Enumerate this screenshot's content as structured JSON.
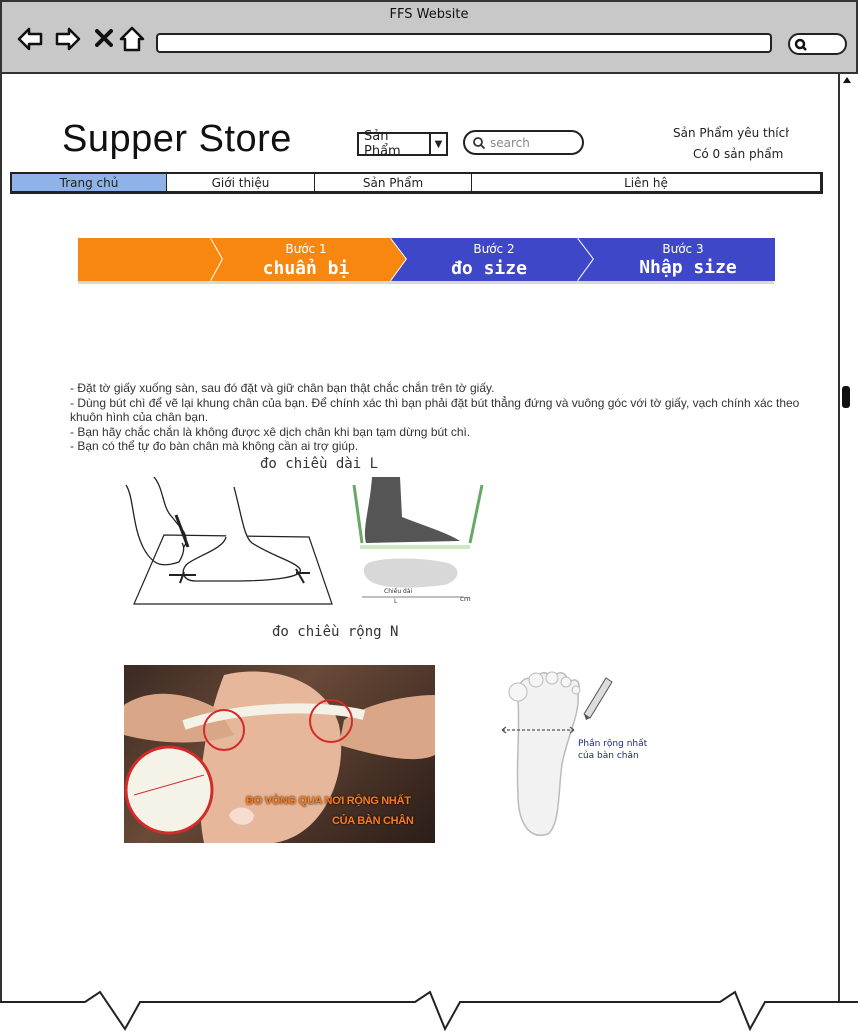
{
  "browser": {
    "title": "FFS Website",
    "icons": [
      "back-arrow-icon",
      "forward-arrow-icon",
      "close-x-icon",
      "home-icon",
      "search-icon"
    ]
  },
  "header": {
    "logo": "Supper Store",
    "category_select": "Sản Phẩm",
    "search_placeholder": "search",
    "favorites": "Sản Phẩm yêu thích",
    "cart": "Có 0 sản phẩm"
  },
  "nav": {
    "items": [
      "Trang chủ",
      "Giới thiệu",
      "Sản Phẩm",
      "Liên hệ"
    ],
    "active_index": 0
  },
  "steps": [
    {
      "label": "",
      "title": ""
    },
    {
      "label": "Bước 1",
      "title": "chuẩn bị"
    },
    {
      "label": "Bước 2",
      "title": "đo size"
    },
    {
      "label": "Bước 3",
      "title": "Nhập size"
    }
  ],
  "instructions": [
    "- Đặt tờ giấy xuống sàn, sau đó đặt và giữ chân bạn thật chắc chắn trên tờ giấy.",
    "- Dùng bút chì để vẽ lại khung chân của bạn. Để chính xác thì bạn phải đặt bút thẳng đứng và vuông góc với tờ giấy, vạch chính xác theo khuôn hình của chân bạn.",
    "- Bạn hãy chắc chắn là không được xê dịch chân khi bạn tạm dừng bút chì.",
    "- Bạn có thể tự đo bàn chân mà không cần ai trợ giúp."
  ],
  "captions": {
    "length": "đo chiều dài L",
    "width": "đo chiều rộng N"
  },
  "image_labels": {
    "length_diagram_label": "Chiều dài",
    "length_diagram_L": "L",
    "length_diagram_unit": "cm",
    "width_photo_text_1": "ĐO VÒNG QUA NƠI RỘNG NHẤT",
    "width_photo_text_2": "CỦA BÀN CHÂN",
    "footprint_label_1": "Phần rộng nhất",
    "footprint_label_2": "của bàn chân"
  },
  "colors": {
    "step_orange": "#f7870f",
    "step_blue": "#3f47c9",
    "nav_active": "#8fb2e8",
    "chrome_gray": "#c8c8c8"
  }
}
